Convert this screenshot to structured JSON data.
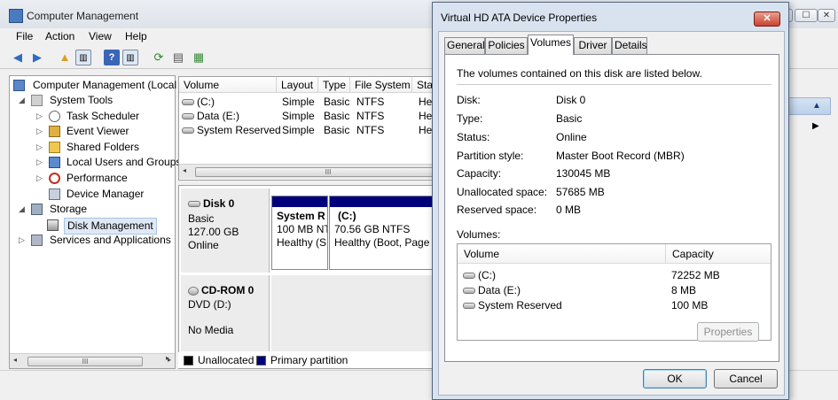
{
  "main_window": {
    "title": "Computer Management",
    "buttons": {
      "min": "—",
      "max": "☐",
      "close": "✕"
    }
  },
  "menu": [
    "File",
    "Action",
    "View",
    "Help"
  ],
  "tree": {
    "root": "Computer Management (Local",
    "system_tools": "System Tools",
    "task_scheduler": "Task Scheduler",
    "event_viewer": "Event Viewer",
    "shared_folders": "Shared Folders",
    "local_users": "Local Users and Groups",
    "performance": "Performance",
    "device_manager": "Device Manager",
    "storage": "Storage",
    "disk_management": "Disk Management",
    "services": "Services and Applications"
  },
  "volume_list": {
    "columns": [
      "Volume",
      "Layout",
      "Type",
      "File System",
      "Sta"
    ],
    "rows": [
      {
        "volume": "(C:)",
        "layout": "Simple",
        "type": "Basic",
        "fs": "NTFS",
        "status": "He"
      },
      {
        "volume": "Data (E:)",
        "layout": "Simple",
        "type": "Basic",
        "fs": "NTFS",
        "status": "He"
      },
      {
        "volume": "System Reserved",
        "layout": "Simple",
        "type": "Basic",
        "fs": "NTFS",
        "status": "He"
      }
    ],
    "scroll_grip": "III"
  },
  "graph": {
    "disk0": {
      "name": "Disk 0",
      "type": "Basic",
      "size": "127.00 GB",
      "status": "Online"
    },
    "part_sysres": {
      "name": "System R",
      "size": "100 MB NTF",
      "status": "Healthy (S"
    },
    "part_c": {
      "name": "(C:)",
      "size": "70.56 GB NTFS",
      "status": "Healthy (Boot, Page"
    },
    "cdrom": {
      "name": "CD-ROM 0",
      "drive": "DVD (D:)",
      "media": "No Media"
    }
  },
  "legend": {
    "unallocated": "Unallocated",
    "primary": "Primary partition"
  },
  "tree_scroll_grip": "III",
  "dialog": {
    "title": "Virtual HD ATA Device Properties",
    "close": "✕",
    "tabs": [
      "General",
      "Policies",
      "Volumes",
      "Driver",
      "Details"
    ],
    "intro": "The volumes contained on this disk are listed below.",
    "props": [
      {
        "label": "Disk:",
        "value": "Disk 0"
      },
      {
        "label": "Type:",
        "value": "Basic"
      },
      {
        "label": "Status:",
        "value": "Online"
      },
      {
        "label": "Partition style:",
        "value": "Master Boot Record (MBR)"
      },
      {
        "label": "Capacity:",
        "value": "130045 MB"
      },
      {
        "label": "Unallocated space:",
        "value": "57685 MB"
      },
      {
        "label": "Reserved space:",
        "value": "0 MB"
      }
    ],
    "volumes_label": "Volumes:",
    "table_headers": [
      "Volume",
      "Capacity"
    ],
    "volumes": [
      {
        "name": "(C:)",
        "capacity": "72252 MB"
      },
      {
        "name": "Data (E:)",
        "capacity": "8 MB"
      },
      {
        "name": "System Reserved",
        "capacity": "100 MB"
      }
    ],
    "properties_btn": "Properties",
    "ok_btn": "OK",
    "cancel_btn": "Cancel"
  },
  "colors": {
    "primary_partition": "#00007c",
    "unallocated": "#000000",
    "accent": "#3c7fb1"
  }
}
